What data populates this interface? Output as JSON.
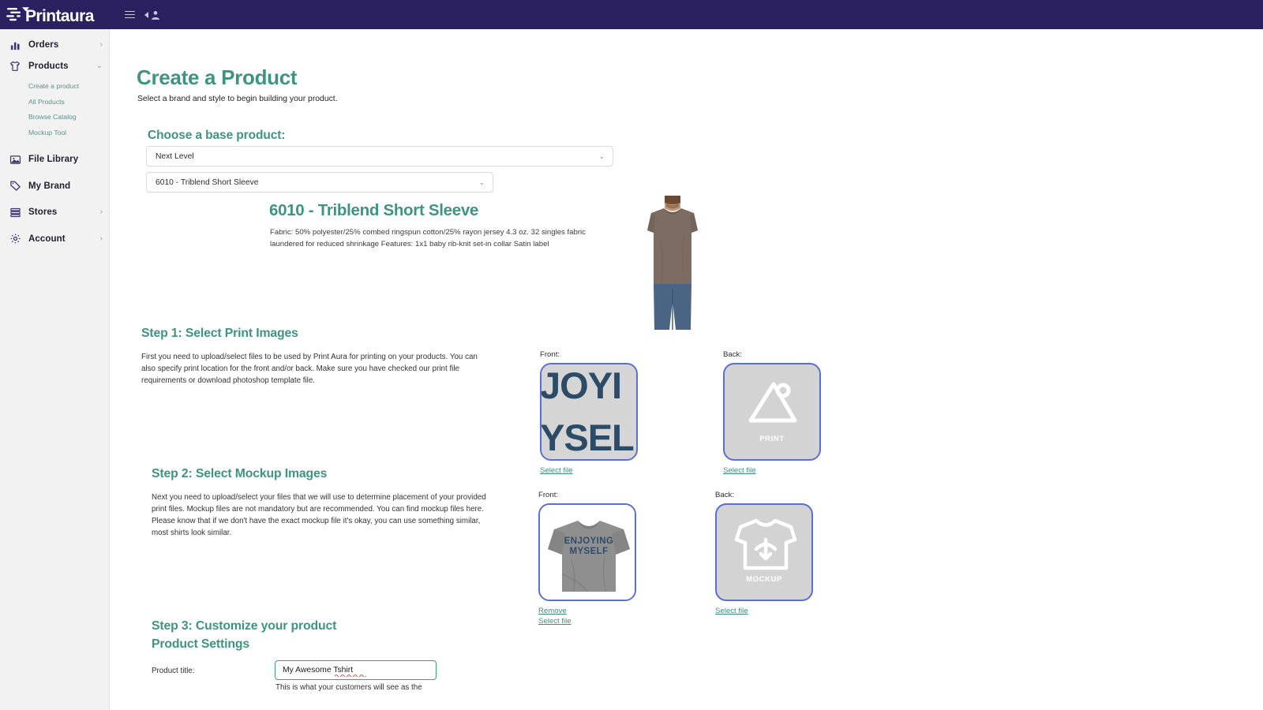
{
  "brand": {
    "logo_text": "Printaura",
    "header_bg": "#2b2160",
    "accent_green": "#3f9480",
    "link_green": "#3f8d7e",
    "thumb_border_blue": "#5a6fd4"
  },
  "topbar": {
    "menu_icon": "hamburger-icon",
    "user_icon": "user-account-icon"
  },
  "sidebar": {
    "items": [
      {
        "label": "Orders",
        "icon": "bar-chart-icon",
        "chevron": "›",
        "expanded": false
      },
      {
        "label": "Products",
        "icon": "tshirt-icon",
        "chevron": "⌄",
        "expanded": true
      },
      {
        "label": "File Library",
        "icon": "image-icon",
        "chevron": "",
        "expanded": false
      },
      {
        "label": "My Brand",
        "icon": "tag-icon",
        "chevron": "",
        "expanded": false
      },
      {
        "label": "Stores",
        "icon": "store-icon",
        "chevron": "›",
        "expanded": false
      },
      {
        "label": "Account",
        "icon": "gear-icon",
        "chevron": "›",
        "expanded": false
      }
    ],
    "products_subitems": [
      "Create a product",
      "All Products",
      "Browse Catalog",
      "Mockup Tool"
    ]
  },
  "page": {
    "title": "Create a Product",
    "subtitle": "Select a brand and style to begin building your product."
  },
  "base_product": {
    "heading": "Choose a base product:",
    "brand_select_value": "Next Level",
    "style_select_value": "6010 - Triblend Short Sleeve",
    "product_name": "6010 - Triblend Short Sleeve",
    "product_description": "Fabric: 50% polyester/25% combed ringspun cotton/25% rayon jersey 4.3 oz. 32 singles fabric laundered for reduced shrinkage  Features: 1x1 baby rib-knit set-in collar Satin label",
    "model_image_alt": "model-wearing-brown-tshirt"
  },
  "step1": {
    "heading": "Step 1: Select Print Images",
    "body": "First you need to upload/select files to be used by Print Aura for printing on your products. You can also specify print location for the front and/or back. Make sure you have checked our print file requirements or download photoshop template file.",
    "front": {
      "label": "Front:",
      "has_file": true,
      "art_line1": "JOYI",
      "art_line2": "YSEL",
      "select_link": "Select file"
    },
    "back": {
      "label": "Back:",
      "has_file": false,
      "placeholder_text": "PRINT",
      "placeholder_icon": "image-mountain-icon",
      "select_link": "Select file"
    }
  },
  "step2": {
    "heading": "Step 2: Select Mockup Images",
    "body": "Next you need to upload/select your files that we will use to determine placement of your provided print files. Mockup files are not mandatory but are recommended. You can find mockup files here. Please know that if we don't have the exact mockup file it's okay, you can use something similar, most shirts look similar.",
    "front": {
      "label": "Front:",
      "has_file": true,
      "shirt_text_line1": "ENJOYING",
      "shirt_text_line2": "MYSELF",
      "remove_link": "Remove",
      "select_link": "Select file"
    },
    "back": {
      "label": "Back:",
      "has_file": false,
      "placeholder_text": "MOCKUP",
      "placeholder_icon": "tshirt-outline-icon",
      "select_link": "Select file"
    }
  },
  "step3": {
    "heading": "Step 3: Customize your product",
    "subheading": "Product Settings",
    "product_title_label": "Product title:",
    "product_title_value": "My Awesome Tshirt",
    "product_title_hint": "This is what your customers will see as the"
  }
}
